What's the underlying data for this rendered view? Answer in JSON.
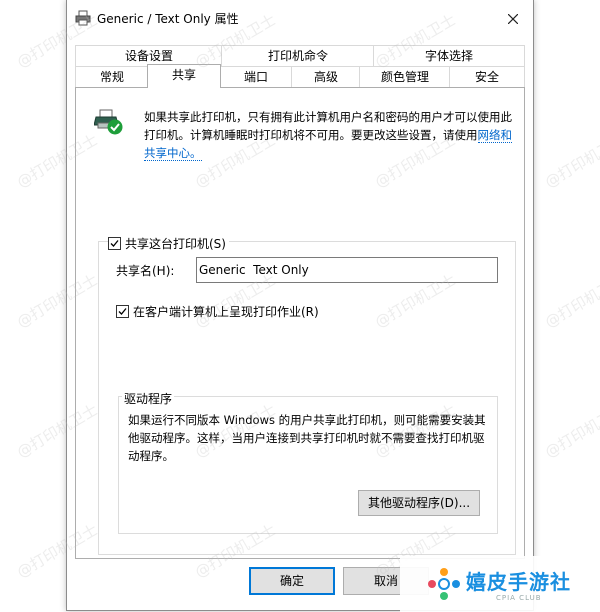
{
  "window": {
    "title": "Generic / Text Only 属性",
    "close_glyph": "✕"
  },
  "tabs_row1": [
    {
      "label": "设备设置"
    },
    {
      "label": "打印机命令"
    },
    {
      "label": "字体选择"
    }
  ],
  "tabs_row2": [
    {
      "label": "常规"
    },
    {
      "label": "共享",
      "active": true
    },
    {
      "label": "端口"
    },
    {
      "label": "高级"
    },
    {
      "label": "颜色管理"
    },
    {
      "label": "安全"
    }
  ],
  "sharing": {
    "description": "如果共享此打印机，只有拥有此计算机用户名和密码的用户才可以使用此打印机。计算机睡眠时打印机将不可用。要更改这些设置，请使用",
    "link_text": "网络和共享中心。",
    "share_checkbox_label": "共享这台打印机(S)",
    "share_checked": true,
    "share_name_label": "共享名(H):",
    "share_name_value": "Generic  Text Only",
    "render_checkbox_label": "在客户端计算机上呈现打印作业(R)",
    "render_checked": true
  },
  "drivers": {
    "legend": "驱动程序",
    "description": "如果运行不同版本 Windows 的用户共享此打印机，则可能需要安装其他驱动程序。这样，当用户连接到共享打印机时就不需要查找打印机驱动程序。",
    "button_label": "其他驱动程序(D)..."
  },
  "footer": {
    "ok_label": "确定",
    "cancel_label": "取消"
  },
  "watermark_text": "@打印机卫士",
  "logo": {
    "name": "嬉皮手游社",
    "sub": "CPIA CLUB"
  },
  "colors": {
    "accent": "#0078d7",
    "link": "#0066cc",
    "check_green": "#1e9e3a",
    "logo_blue": "#1a8fe0"
  }
}
